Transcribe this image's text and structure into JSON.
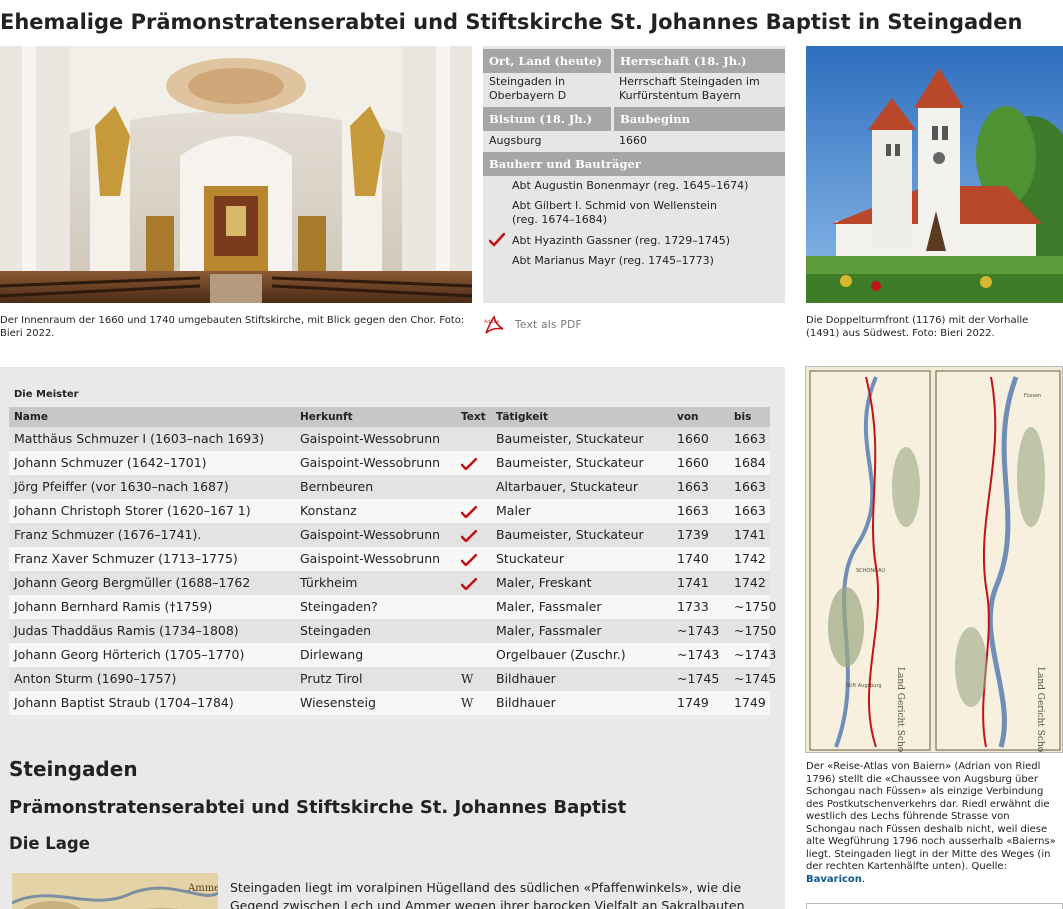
{
  "page": {
    "title": "Ehemalige Prämonstratenserabtei und Stiftskirche St. Johannes Baptist in Steingaden"
  },
  "photos": {
    "interior_caption": "Der Innenraum der 1660 und 1740 umgebauten Stiftskirche, mit Blick gegen den Chor. Foto: Bieri 2022.",
    "church_caption": "Die Doppelturmfront (1176) mit der Vorhalle (1491) aus Südwest. Foto: Bieri 2022."
  },
  "info": {
    "ort_label": "Ort, Land (heute)",
    "ort_value": "Steingaden in Oberbayern D",
    "herrschaft_label": "Herrschaft (18. Jh.)",
    "herrschaft_value": "Herrschaft Steingaden im Kurfürstentum Bayern",
    "bistum_label": "Bistum (18. Jh.)",
    "bistum_value": "Augsburg",
    "baubeginn_label": "Baubeginn",
    "baubeginn_value": "1660",
    "bauherr_label": "Bauherr und Bauträger",
    "bauherren": [
      {
        "name": "Abt Augustin Bonenmayr (reg. 1645–1674)",
        "checked": false
      },
      {
        "name": "Abt Gilbert I. Schmid von Wellenstein (reg. 1674–1684)",
        "checked": false
      },
      {
        "name": "Abt Hyazinth Gassner (reg. 1729–1745)",
        "checked": true
      },
      {
        "name": "Abt Marianus Mayr (reg. 1745–1773)",
        "checked": false
      }
    ]
  },
  "pdf": {
    "icon_label": "Adobe",
    "label": "Text als PDF"
  },
  "masters": {
    "title": "Die Meister",
    "columns": [
      "Name",
      "Herkunft",
      "Text",
      "Tätigkeit",
      "von",
      "bis"
    ],
    "rows": [
      {
        "name": "Matthäus Schmuzer I (1603–nach 1693)",
        "herkunft": "Gaispoint-Wessobrunn",
        "text": "",
        "taetigkeit": "Baumeister, Stuckateur",
        "von": "1660",
        "bis": "1663"
      },
      {
        "name": "Johann Schmuzer (1642–1701)",
        "herkunft": "Gaispoint-Wessobrunn",
        "text": "check",
        "taetigkeit": "Baumeister, Stuckateur",
        "von": "1660",
        "bis": "1684"
      },
      {
        "name": "Jörg Pfeiffer (vor 1630–nach 1687)",
        "herkunft": "Bernbeuren",
        "text": "",
        "taetigkeit": "Altarbauer, Stuckateur",
        "von": "1663",
        "bis": "1663"
      },
      {
        "name": "Johann Christoph Storer (1620–167 1)",
        "herkunft": "Konstanz",
        "text": "check",
        "taetigkeit": "Maler",
        "von": "1663",
        "bis": "1663"
      },
      {
        "name": "Franz Schmuzer (1676–1741).",
        "herkunft": "Gaispoint-Wessobrunn",
        "text": "check",
        "taetigkeit": "Baumeister, Stuckateur",
        "von": "1739",
        "bis": "1741"
      },
      {
        "name": "Franz Xaver Schmuzer (1713–1775)",
        "herkunft": "Gaispoint-Wessobrunn",
        "text": "check",
        "taetigkeit": "Stuckateur",
        "von": "1740",
        "bis": "1742"
      },
      {
        "name": "Johann Georg Bergmüller (1688–1762",
        "herkunft": "Türkheim",
        "text": "check",
        "taetigkeit": "Maler, Freskant",
        "von": "1741",
        "bis": "1742"
      },
      {
        "name": "Johann Bernhard Ramis (†1759)",
        "herkunft": "Steingaden?",
        "text": "",
        "taetigkeit": "Maler, Fassmaler",
        "von": "1733",
        "bis": "~1750"
      },
      {
        "name": "Judas Thaddäus Ramis (1734–1808)",
        "herkunft": "Steingaden",
        "text": "",
        "taetigkeit": "Maler, Fassmaler",
        "von": "~1743",
        "bis": "~1750"
      },
      {
        "name": "Johann Georg Hörterich (1705–1770)",
        "herkunft": "Dirlewang",
        "text": "",
        "taetigkeit": "Orgelbauer (Zuschr.)",
        "von": "~1743",
        "bis": "~1743"
      },
      {
        "name": "Anton Sturm (1690–1757)",
        "herkunft": "Prutz Tirol",
        "text": "W",
        "taetigkeit": "Bildhauer",
        "von": "~1745",
        "bis": "~1745"
      },
      {
        "name": "Johann Baptist Straub (1704–1784)",
        "herkunft": "Wiesensteig",
        "text": "W",
        "taetigkeit": "Bildhauer",
        "von": "1749",
        "bis": "1749"
      }
    ]
  },
  "article": {
    "place": "Steingaden",
    "subtitle": "Prämonstratenserabtei und Stiftskirche St. Johannes Baptist",
    "section": "Die Lage",
    "paragraph": "Steingaden liegt im voralpinen Hügelland des südlichen «Pfaffenwinkels», wie die Gegend zwischen Lech und Ammer wegen ihrer barocken Vielfalt an Sakralbauten auch genannt"
  },
  "map": {
    "caption": "Der «Reise-Atlas von Baiern» (Adrian von Riedl 1796) stellt die «Chaussee von Augsburg über Schongau nach Füssen» als einzige Verbindung des Postkutschenverkehrs dar. Riedl erwähnt die westlich des Lechs führende Strasse von Schongau nach Füssen deshalb nicht, weil diese alte Wegführung 1796 noch ausserhalb «Baierns» liegt. Steingaden liegt in der Mitte des Weges (in der rechten Kartenhälfte unten).",
    "source_label": "Quelle:",
    "source_link": "Bavaricon",
    "source_suffix": ".",
    "labels": [
      "Land Gericht Schongau",
      "Land Gericht Schongau",
      "SCHONGAU",
      "Füssen",
      "Stift Augsburg"
    ],
    "thumb_label": "Ammer"
  },
  "colors": {
    "accent_red": "#c0141b",
    "info_header": "#a6a6a6",
    "panel_bg": "#e6e6e6",
    "link": "#0a5a8c"
  }
}
